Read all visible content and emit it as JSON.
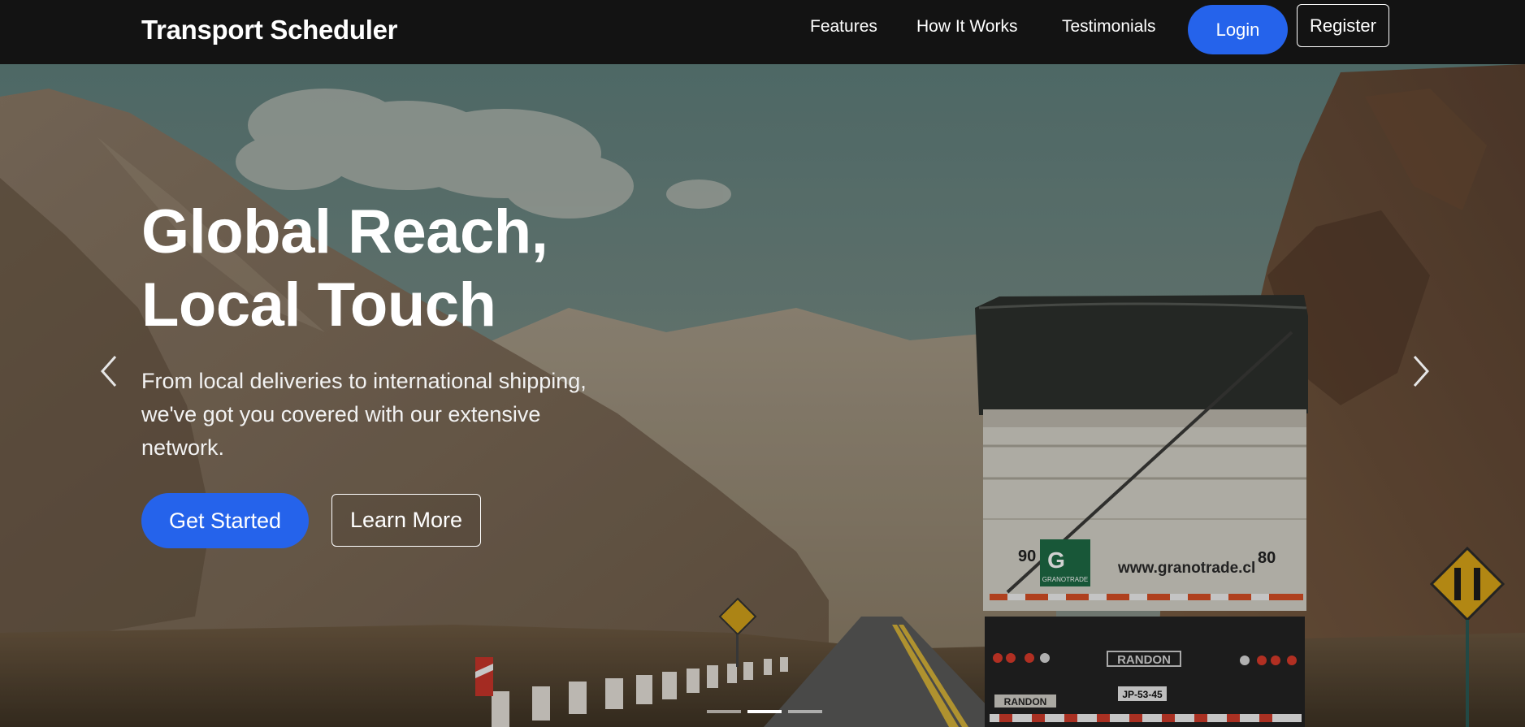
{
  "navbar": {
    "brand": "Transport Scheduler",
    "links": [
      "Features",
      "How It Works",
      "Testimonials"
    ],
    "login_label": "Login",
    "register_label": "Register"
  },
  "hero": {
    "title_line1": "Global Reach,",
    "title_line2": "Local Touch",
    "subtitle": "From local deliveries to international shipping, we've got you covered with our extensive network.",
    "primary_cta": "Get Started",
    "secondary_cta": "Learn More",
    "carousel": {
      "slide_count": 3,
      "active_index": 1
    },
    "truck": {
      "number_left": "90",
      "number_right": "80",
      "website": "www.granotrade.cl",
      "logo_text": "GRANOTRADE",
      "brand_plate": "RANDON",
      "brand_plate_bottom": "RANDON",
      "license_plate": "JP-53-45"
    }
  },
  "colors": {
    "accent": "#2563eb",
    "navbar_bg": "#131313"
  }
}
